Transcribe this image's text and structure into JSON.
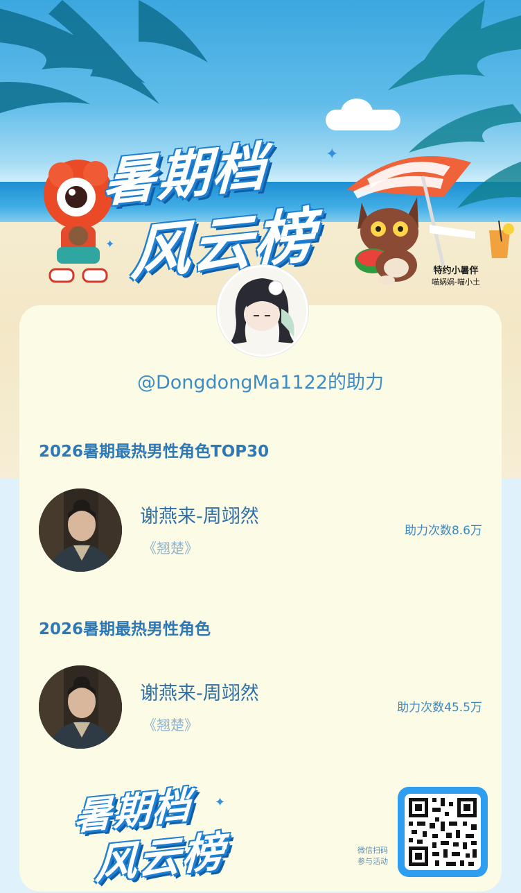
{
  "banner": {
    "title_line1": "暑期档",
    "title_line2": "风云榜",
    "sponsor_title": "特约小暑伴",
    "sponsor_names": "喵娲娲-喵小土"
  },
  "user": {
    "handle": "@DongdongMa1122的助力"
  },
  "sections": [
    {
      "title": "2026暑期最热男性角色TOP30",
      "entry": {
        "name": "谢燕来-周翊然",
        "work": "《翘楚》",
        "count": "助力次数8.6万"
      }
    },
    {
      "title": "2026暑期最热男性角色",
      "entry": {
        "name": "谢燕来-周翊然",
        "work": "《翘楚》",
        "count": "助力次数45.5万"
      }
    }
  ],
  "footer": {
    "logo_line1": "暑期档",
    "logo_line2": "风云榜",
    "qr_caption_line1": "微信扫码",
    "qr_caption_line2": "参与活动"
  },
  "colors": {
    "accent": "#2f78b6",
    "qr_frame": "#2e9ef0",
    "card": "#fbfbe6"
  }
}
